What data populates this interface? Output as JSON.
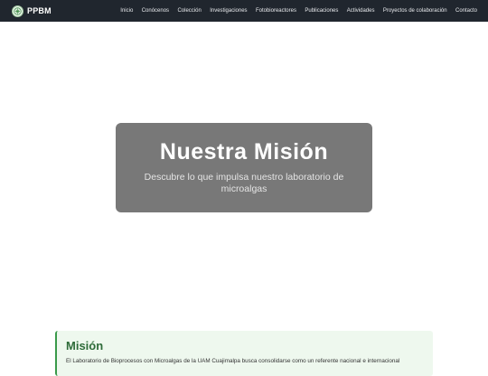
{
  "brand": {
    "name": "PPBM",
    "logo_icon": "leaf-logo-icon"
  },
  "nav": {
    "items": [
      {
        "label": "Inicio"
      },
      {
        "label": "Conócenos"
      },
      {
        "label": "Colección"
      },
      {
        "label": "Investigaciones"
      },
      {
        "label": "Fotobioreactores"
      },
      {
        "label": "Publicaciones"
      },
      {
        "label": "Actividades"
      },
      {
        "label": "Proyectos de colaboración"
      },
      {
        "label": "Contacto"
      }
    ]
  },
  "hero": {
    "title": "Nuestra Misión",
    "subtitle": "Descubre lo que impulsa nuestro laboratorio de microalgas"
  },
  "mission": {
    "title": "Misión",
    "text": "El Laboratorio de Bioprocesos con Microalgas de la UAM Cuajimalpa busca consolidarse como un referente nacional e internacional"
  },
  "colors": {
    "navbar_bg": "#20262e",
    "hero_box_bg": "#787878",
    "mission_bg": "#eef8ee",
    "mission_accent": "#3a9a4a",
    "mission_title": "#2e6b39"
  }
}
